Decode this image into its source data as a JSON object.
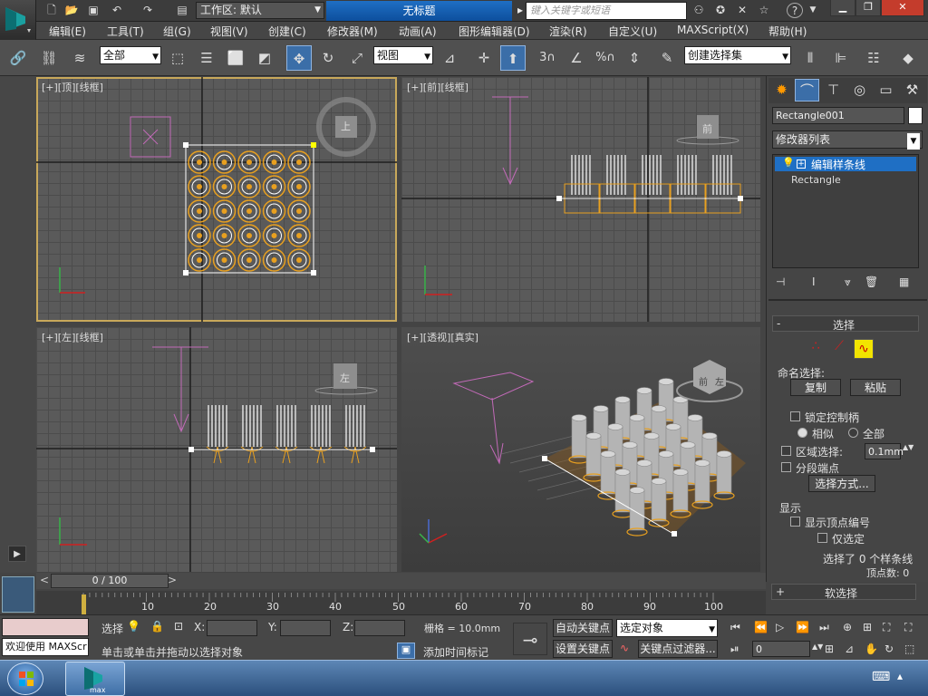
{
  "app": {
    "workspace_label": "工作区: 默认",
    "document_title": "无标题",
    "search_placeholder": "键入关键字或短语"
  },
  "menu": [
    "编辑(E)",
    "工具(T)",
    "组(G)",
    "视图(V)",
    "创建(C)",
    "修改器(M)",
    "动画(A)",
    "图形编辑器(D)",
    "渲染(R)",
    "自定义(U)",
    "MAXScript(X)",
    "帮助(H)"
  ],
  "toolbar": {
    "selection_filter": "全部",
    "reference_coord": "视图",
    "named_selection_set": "创建选择集",
    "snap_3_label": "3",
    "percent_label": "%"
  },
  "viewports": {
    "top": {
      "label": "[+][顶][线框]",
      "cube_label": "上"
    },
    "front": {
      "label": "[+][前][线框]",
      "cube_label": "前"
    },
    "left": {
      "label": "[+][左][线框]",
      "cube_label": "左"
    },
    "perspective": {
      "label": "[+][透视][真实]",
      "cube_front": "前",
      "cube_left": "左"
    }
  },
  "command_panel": {
    "object_name": "Rectangle001",
    "modifier_list": "修改器列表",
    "stack": [
      {
        "label": "编辑样条线",
        "selected": true
      },
      {
        "label": "Rectangle",
        "selected": false
      }
    ],
    "selection_rollout": {
      "title": "选择",
      "collapse": "-",
      "named_selection_label": "命名选择:",
      "copy_button": "复制",
      "paste_button": "粘贴",
      "lock_handles": "锁定控制柄",
      "similar": "相似",
      "all": "全部",
      "area_select": "区域选择:",
      "area_value": "0.1mm",
      "segment_end": "分段端点",
      "select_by_button": "选择方式...",
      "display_group": "显示",
      "show_vertex_numbers": "显示顶点编号",
      "selected_only": "仅选定",
      "status_line1": "选择了 0 个样条线",
      "status_line2": "顶点数: 0"
    },
    "soft_selection": {
      "title": "软选择",
      "expand": "+"
    }
  },
  "timeline": {
    "position_label": "0 / 100",
    "ticks": [
      "10",
      "20",
      "30",
      "40",
      "50",
      "60",
      "70",
      "80",
      "90",
      "100"
    ]
  },
  "status": {
    "welcome": "欢迎使用 MAXScr",
    "select_label": "选择",
    "x_label": "X:",
    "y_label": "Y:",
    "z_label": "Z:",
    "grid": "栅格 = 10.0mm",
    "auto_key": "自动关键点",
    "selected_object": "选定对象",
    "set_key": "设置关键点",
    "key_filters": "关键点过滤器...",
    "prompt": "单击或单击并拖动以选择对象",
    "add_time_tag": "添加时间标记",
    "frame_value": "0"
  },
  "taskbar": {
    "app_label": "max"
  },
  "colors": {
    "accent_blue": "#1f6fc4",
    "selection_orange": "#e8a020",
    "shape_pink": "#d070c0",
    "selected_white": "#ffffff"
  }
}
